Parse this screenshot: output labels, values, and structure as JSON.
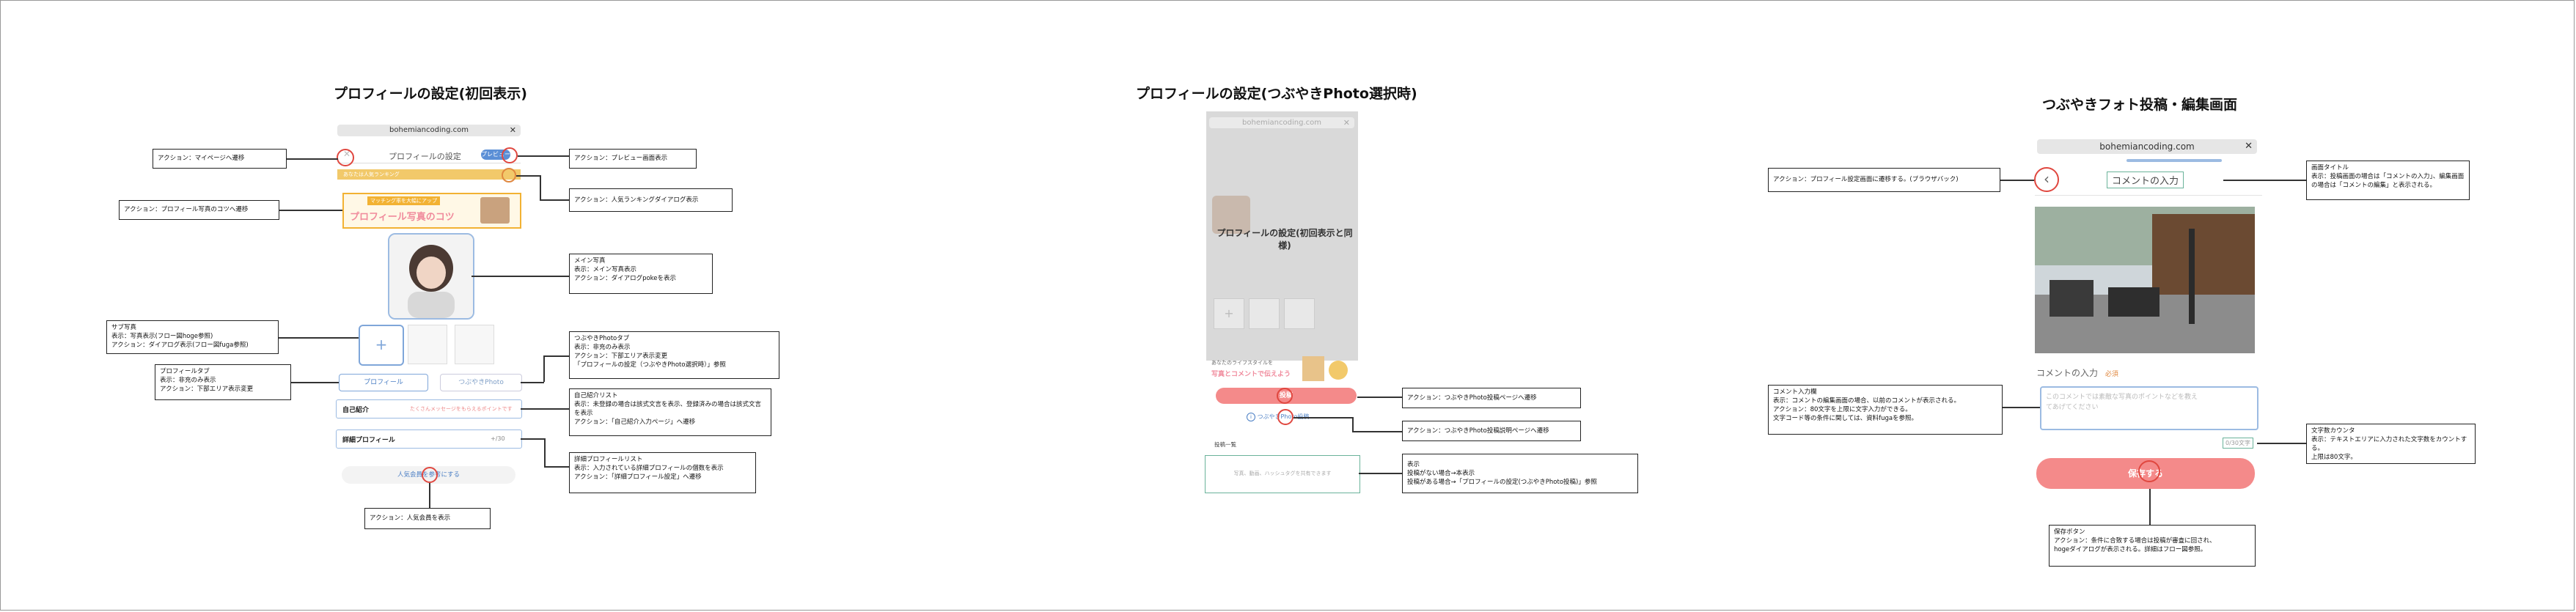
{
  "titles": {
    "s1": "プロフィールの設定(初回表示)",
    "s2": "プロフィールの設定(つぶやきPhoto選択時)",
    "s3": "つぶやきフォト投稿・編集画面"
  },
  "browser": {
    "url": "bohemiancoding.com",
    "close": "✕"
  },
  "s1": {
    "header_title": "プロフィールの設定",
    "preview_pill": "プレビュー",
    "ranking_bar": "あなたは人気ランキング",
    "banner_top": "マッチング率を大幅にアップ",
    "banner_main": "プロフィール写真のコツ",
    "sub_add": "+",
    "tab_profile": "プロフィール",
    "tab_photo": "つぶやきPhoto",
    "intro_label": "自己紹介",
    "intro_placeholder": "たくさんメッセージをもらえるポイントです",
    "detail_label": "詳細プロフィール",
    "detail_count": "+/30",
    "popular_button": "人気会員を参考にする",
    "notes": {
      "mypage": "アクション：マイページへ遷移",
      "preview": "アクション：プレビュー画面表示",
      "tips": "アクション：プロフィール写真のコツへ遷移",
      "ranking": "アクション：人気ランキングダイアログ表示",
      "main_photo": "メイン写真\n表示：メイン写真表示\nアクション：ダイアログpokeを表示",
      "sub_photo": "サブ写真\n表示：写真表示(フロー図hoge参照)\nアクション：ダイアログ表示(フロー図fuga参照)",
      "photo_tab": "つぶやきPhotoタブ\n表示：非充のみ表示\nアクション：下部エリア表示変更\n「プロフィールの設定（つぶやきPhoto選択時）」参照",
      "profile_tab": "プロフィールタブ\n表示：非充のみ表示\nアクション：下部エリア表示変更",
      "intro_list": "自己紹介リスト\n表示：未登録の場合は該式文言を表示、登録済みの場合は該式文言を表示\nアクション：「自己紹介入力ページ」へ遷移",
      "detail_list": "詳細プロフィールリスト\n表示：入力されている詳細プロフィールの個数を表示\nアクション：「詳細プロフィール設定」へ遷移",
      "popular": "アクション：人気会員を表示"
    }
  },
  "s2": {
    "overlay_text": "プロフィールの設定(初回表示と同様)",
    "banner_small": "あなたのライフスタイルを",
    "banner_main": "写真とコメントで伝えよう",
    "post_button": "投稿",
    "photo_link": "つぶやきPhoto投稿",
    "list_label": "投稿一覧",
    "empty_text": "写真、動画、ハッシュタグを共有できます",
    "notes": {
      "post": "アクション：つぶやきPhoto投稿ページへ遷移",
      "link": "アクション：つぶやきPhoto投稿説明ページへ遷移",
      "list": "表示\n投稿がない場合→本表示\n投稿がある場合→「プロフィールの設定(つぶやきPhoto投稿)」参照"
    }
  },
  "s3": {
    "header_title": "コメントの入力",
    "comment_label": "コメントの入力",
    "required": "必須",
    "textarea_text": "このコメントでは素敵な写真のポイントなどを教えてあげてください",
    "counter": "0/30文字",
    "save_button": "保存する",
    "notes": {
      "back": "アクション：プロフィール設定画面に遷移する。(ブラウザバック)",
      "title": "画面タイトル\n表示：投稿画面の場合は「コメントの入力」、編集画面の場合は「コメントの編集」と表示される。",
      "comment": "コメント入力欄\n表示：コメントの編集画面の場合、以前のコメントが表示される。\nアクション：80文字を上限に文字入力ができる。\n文字コード等の条件に関しては、資料fugaを参照。",
      "counter": "文字数カウンタ\n表示：テキストエリアに入力された文字数をカウントする。\n上限は80文字。",
      "save": "保存ボタン\nアクション：条件に合致する場合は投稿が審査に回され、\nhogeダイアログが表示される。詳細はフロー図参照。"
    }
  },
  "colors": {
    "accent_red": "#e0473f",
    "pink": "#f48a8a",
    "blue": "#4a7ec4",
    "gold": "#f2b233"
  }
}
